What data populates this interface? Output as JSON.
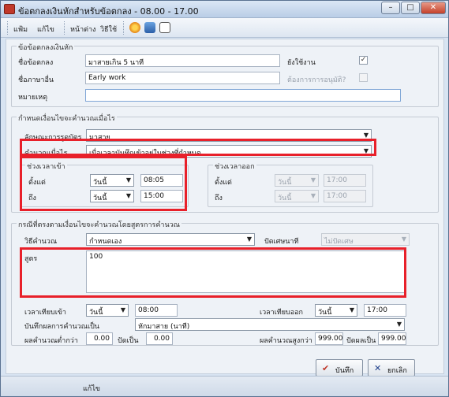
{
  "window": {
    "title": "ข้อตกลงเงินหักสำหรับข้อตกลง - 08.00 - 17.00",
    "min": "–",
    "max": "□",
    "close": "✕"
  },
  "menu": {
    "items": [
      "แฟ้ม",
      "แก้ไข",
      "หน้าต่าง",
      "วิธีใช้"
    ]
  },
  "toolbar": {
    "icons": [
      "help-icon",
      "window-icon",
      "calculator-icon"
    ]
  },
  "agreement": {
    "legend": "ข้อข้อตกลงเงินหัก",
    "name_label": "ชื่อข้อตกลง",
    "name_value": "มาสายเกิน 5 นาที",
    "active_label": "ยังใช้งาน",
    "active_checked": true,
    "alt_name_label": "ชื่อภาษาอื่น",
    "alt_name_value": "Early work",
    "approval_label": "ต้องการการอนุมัติ?",
    "approval_checked": false,
    "note_label": "หมายเหตุ",
    "note_value": ""
  },
  "conditions": {
    "legend": "กำหนดเงื่อนไขจะคำนวณเมื่อไร",
    "timing_type_label": "ลักษณะการรูดบัตร",
    "timing_type_value": "มาสาย",
    "calc_when_label": "คำนวณเมื่อไร",
    "calc_when_value": "เมื่อเวลาบันทึกเข้าอยู่ในช่วงที่กำหนด",
    "in_period": {
      "legend": "ช่วงเวลาเข้า",
      "from_label": "ตั้งแต่",
      "from_day": "วันนี้",
      "from_time": "08:05",
      "to_label": "ถึง",
      "to_day": "วันนี้",
      "to_time": "15:00"
    },
    "out_period": {
      "legend": "ช่วงเวลาออก",
      "from_label": "ตั้งแต่",
      "from_day": "วันนี้",
      "from_time": "17:00",
      "to_label": "ถึง",
      "to_day": "วันนี้",
      "to_time": "17:00"
    }
  },
  "formula": {
    "legend": "กรณีที่ตรงตามเงื่อนไขจะคำนวณโดยสูตรการคำนวณ",
    "method_label": "วิธีคำนวณ",
    "method_value": "กำหนดเอง",
    "rounding_label": "ปัดเศษนาที",
    "rounding_value": "ไม่ปัดเศษ",
    "formula_label": "สูตร",
    "formula_value": "100",
    "time_in_label": "เวลาเทียบเข้า",
    "time_in_day": "วันนี้",
    "time_in_value": "08:00",
    "time_out_label": "เวลาเทียบออก",
    "time_out_day": "วันนี้",
    "time_out_value": "17:00",
    "record_as_label": "บันทึกผลการคำนวณเป็น",
    "record_as_value": "หักมาสาย (นาที)",
    "min_result_label": "ผลคำนวณต่ำกว่า",
    "min_result_value": "0.00",
    "min_round_label": "ปัดเป็น",
    "min_round_value": "0.00",
    "max_result_label": "ผลคำนวณสูงกว่า",
    "max_result_value": "999.00",
    "max_round_label": "ปัดผลเป็น",
    "max_round_value": "999.00"
  },
  "buttons": {
    "save": "บันทึก",
    "cancel": "ยกเลิก"
  },
  "status": {
    "mode": "แก้ไข"
  },
  "colors": {
    "highlight": "#e8202a",
    "window_bg": "#d8e4f2",
    "content_bg": "#eef2f7"
  }
}
